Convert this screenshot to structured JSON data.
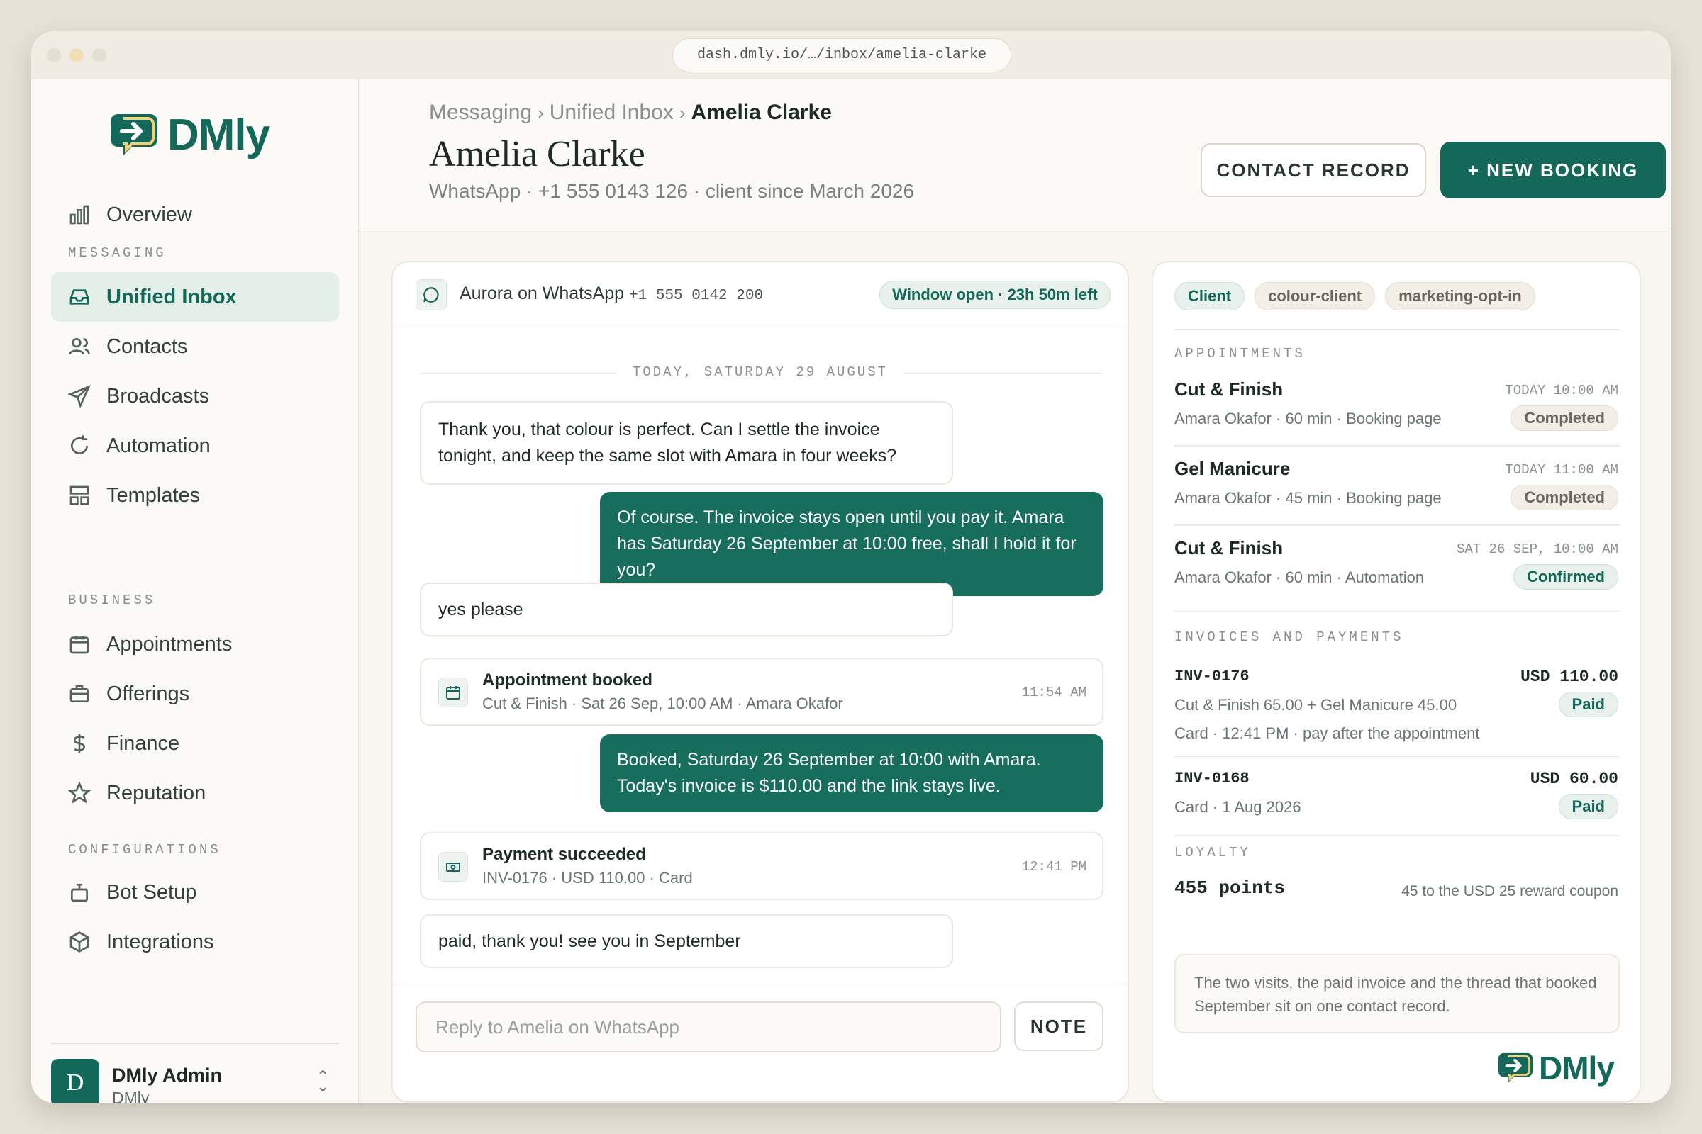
{
  "browser": {
    "url": "dash.dmly.io/…/inbox/amelia-clarke"
  },
  "brand": {
    "name": "DMly",
    "color": "#14685a"
  },
  "sidebar": {
    "overview": {
      "label": "Overview",
      "icon": "bar-chart-icon"
    },
    "sections": {
      "messaging": "MESSAGING",
      "business": "BUSINESS",
      "configurations": "CONFIGURATIONS"
    },
    "messaging_items": [
      {
        "label": "Unified Inbox",
        "icon": "inbox-icon",
        "active": true
      },
      {
        "label": "Contacts",
        "icon": "users-icon"
      },
      {
        "label": "Broadcasts",
        "icon": "send-icon"
      },
      {
        "label": "Automation",
        "icon": "refresh-icon"
      },
      {
        "label": "Templates",
        "icon": "template-icon"
      }
    ],
    "business_items": [
      {
        "label": "Appointments",
        "icon": "calendar-icon"
      },
      {
        "label": "Offerings",
        "icon": "briefcase-icon"
      },
      {
        "label": "Finance",
        "icon": "dollar-icon"
      },
      {
        "label": "Reputation",
        "icon": "star-icon"
      }
    ],
    "config_items": [
      {
        "label": "Bot Setup",
        "icon": "bot-icon"
      },
      {
        "label": "Integrations",
        "icon": "cube-icon"
      }
    ],
    "user": {
      "initial": "D",
      "name": "DMly Admin",
      "org": "DMly"
    }
  },
  "header": {
    "breadcrumb": [
      "Messaging",
      "Unified Inbox",
      "Amelia Clarke"
    ],
    "breadcrumb_sep": "›",
    "title": "Amelia Clarke",
    "subtitle": "WhatsApp · +1 555 0143 126 · client since March 2026",
    "contact_record_label": "CONTACT RECORD",
    "new_booking_label": "+  NEW BOOKING"
  },
  "conversation": {
    "channel": "Aurora on WhatsApp",
    "channel_number": "+1 555 0142 200",
    "window_status": "Window open · 23h 50m left",
    "day_label": "TODAY, SATURDAY 29 AUGUST",
    "messages": [
      {
        "type": "in",
        "text": "Thank you, that colour is perfect. Can I settle the invoice tonight, and keep the same slot with Amara in four weeks?"
      },
      {
        "type": "out",
        "text": "Of course. The invoice stays open until you pay it. Amara has Saturday 26 September at 10:00 free, shall I hold it for you?"
      },
      {
        "type": "in",
        "text": "yes please"
      },
      {
        "type": "event",
        "title": "Appointment booked",
        "sub": "Cut & Finish · Sat 26 Sep, 10:00 AM · Amara Okafor",
        "time": "11:54 AM",
        "icon": "calendar-icon"
      },
      {
        "type": "out",
        "text": "Booked, Saturday 26 September at 10:00 with Amara. Today's invoice is $110.00 and the link stays live."
      },
      {
        "type": "event",
        "title": "Payment succeeded",
        "sub": "INV-0176 · USD 110.00 · Card",
        "time": "12:41 PM",
        "icon": "cash-icon"
      },
      {
        "type": "in",
        "text": "paid, thank you! see you in September"
      }
    ],
    "reply_placeholder": "Reply to Amelia on WhatsApp",
    "note_label": "NOTE"
  },
  "contact_panel": {
    "tags": [
      "Client",
      "colour-client",
      "marketing-opt-in"
    ],
    "appointments_label": "APPOINTMENTS",
    "appointments": [
      {
        "title": "Cut & Finish",
        "time": "TODAY 10:00 AM",
        "sub": "Amara Okafor · 60 min · Booking page",
        "status": "Completed"
      },
      {
        "title": "Gel Manicure",
        "time": "TODAY 11:00 AM",
        "sub": "Amara Okafor · 45 min · Booking page",
        "status": "Completed"
      },
      {
        "title": "Cut & Finish",
        "time": "SAT 26 SEP, 10:00 AM",
        "sub": "Amara Okafor · 60 min · Automation",
        "status": "Confirmed"
      }
    ],
    "invoices_label": "INVOICES AND PAYMENTS",
    "invoices": [
      {
        "id": "INV-0176",
        "amount": "USD 110.00",
        "line1": "Cut & Finish 65.00 + Gel Manicure 45.00",
        "line2": "Card · 12:41 PM · pay after the appointment",
        "status": "Paid"
      },
      {
        "id": "INV-0168",
        "amount": "USD 60.00",
        "line1": "Card · 1 Aug 2026",
        "status": "Paid"
      }
    ],
    "loyalty_label": "LOYALTY",
    "loyalty_points": "455 points",
    "loyalty_note": "45 to the USD 25 reward coupon",
    "summary": "The two visits, the paid invoice and the thread that booked September sit on one contact record."
  }
}
